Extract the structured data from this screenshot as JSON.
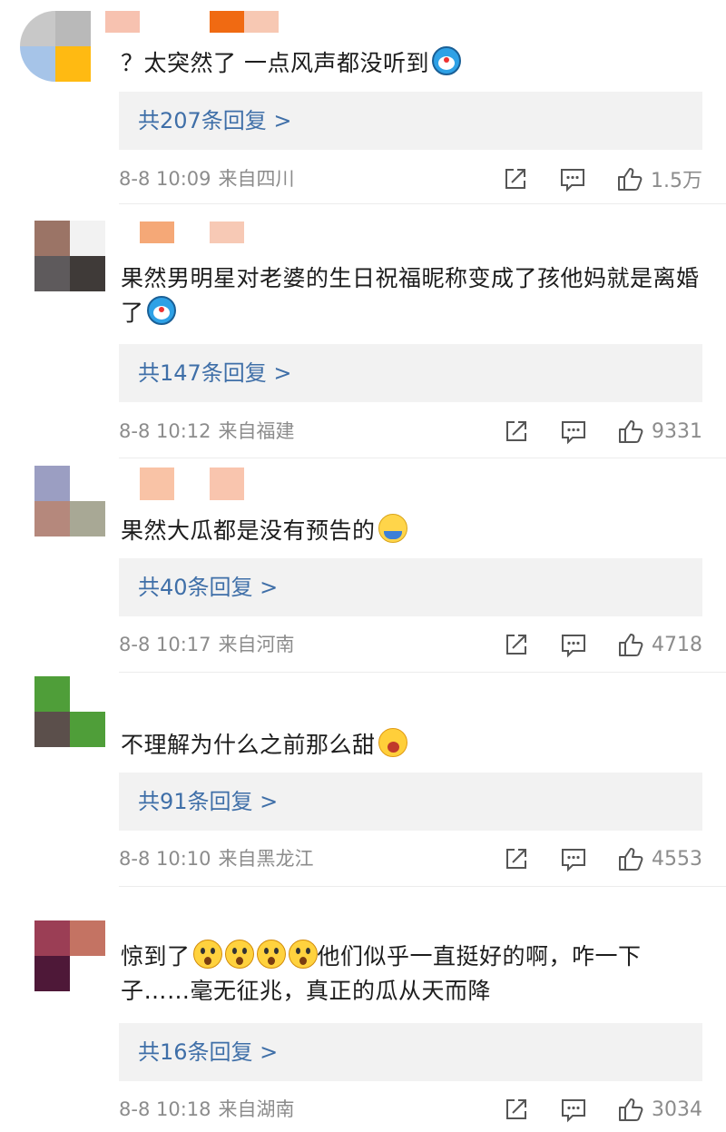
{
  "comments": [
    {
      "text": "？太突然了 一点风声都没听到",
      "emoji": "doraemon-emoji",
      "replies": "共207条回复 >",
      "date": "8-8 10:09",
      "location": "来自四川",
      "likes": "1.5万"
    },
    {
      "text": "果然男明星对老婆的生日祝福昵称变成了孩他妈就是离婚了",
      "emoji": "doraemon-emoji",
      "replies": "共147条回复 >",
      "date": "8-8 10:12",
      "location": "来自福建",
      "likes": "9331"
    },
    {
      "text": "果然大瓜都是没有预告的",
      "emoji": "blank-stare-emoji",
      "replies": "共40条回复 >",
      "date": "8-8 10:17",
      "location": "来自河南",
      "likes": "4718"
    },
    {
      "text": "不理解为什么之前那么甜",
      "emoji": "crying-emoji",
      "replies": "共91条回复 >",
      "date": "8-8 10:10",
      "location": "来自黑龙江",
      "likes": "4553"
    },
    {
      "text_a": "惊到了",
      "text_b": "他们似乎一直挺好的啊，咋一下子……毫无征兆，真正的瓜从天而降",
      "emoji": "shocked-emoji",
      "replies": "共16条回复 >",
      "date": "8-8 10:18",
      "location": "来自湖南",
      "likes": "3034"
    }
  ],
  "icons": {
    "share": "share-icon",
    "comment": "comment-icon",
    "like": "thumbs-up-icon"
  },
  "colors": {
    "reply_link": "#3f6fa8",
    "meta_text": "#8c8c8c",
    "reply_bg": "#f2f2f2"
  }
}
